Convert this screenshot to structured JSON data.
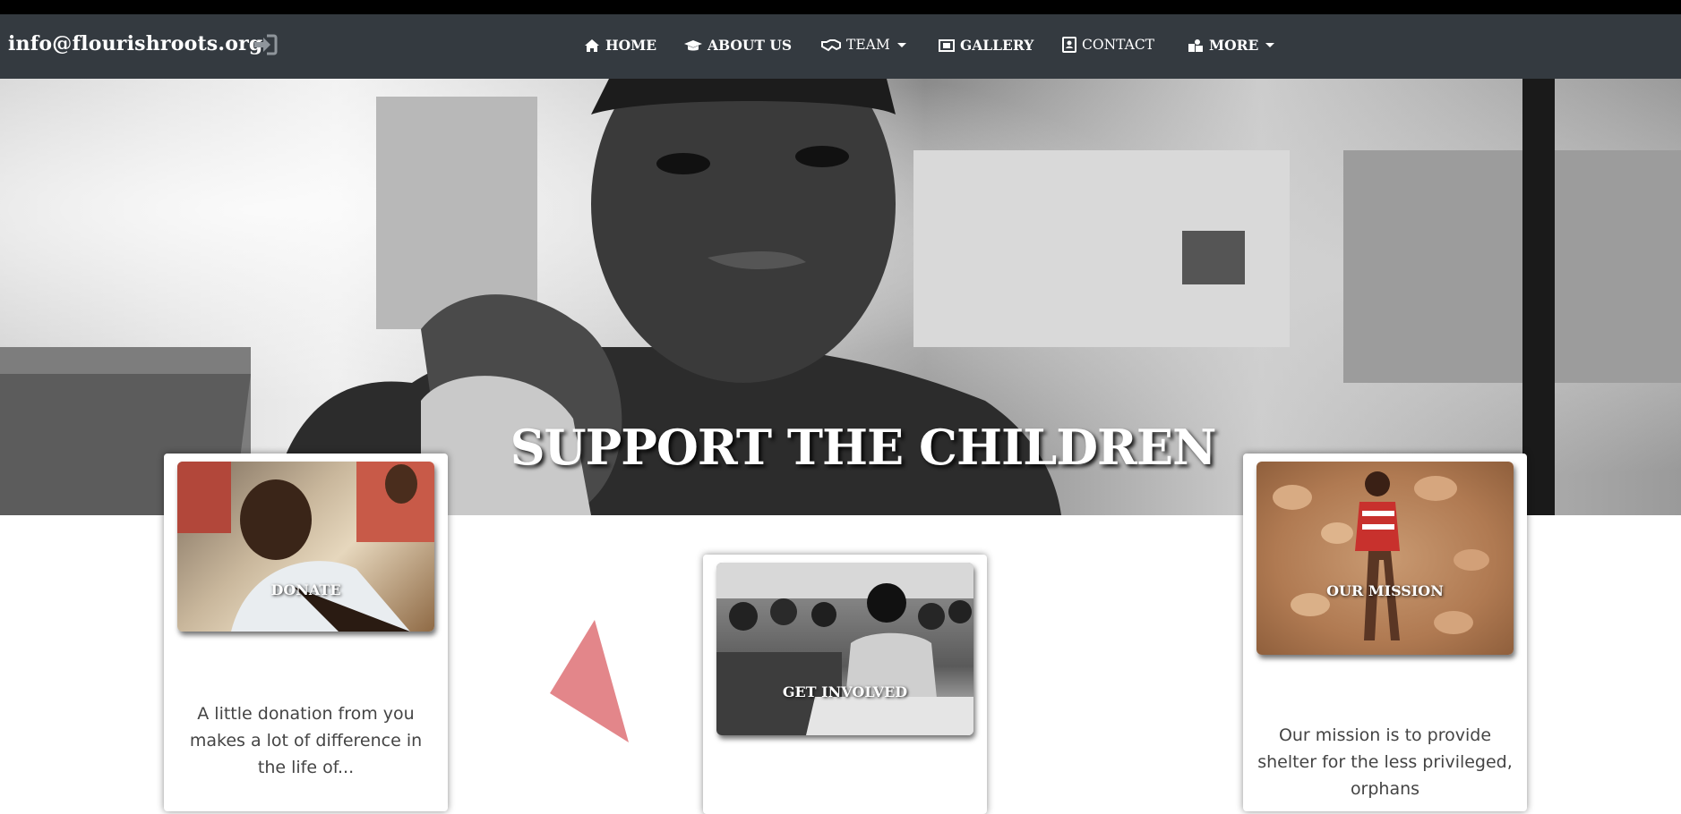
{
  "brand": {
    "email": "info@flourishroots.org",
    "login_icon": "sign-in-icon"
  },
  "nav": {
    "items": [
      {
        "label": "HOME",
        "icon": "home-icon",
        "dropdown": false
      },
      {
        "label": "ABOUT US",
        "icon": "graduation-cap-icon",
        "dropdown": false
      },
      {
        "label": "TEAM",
        "icon": "handshake-icon",
        "dropdown": true
      },
      {
        "label": "GALLERY",
        "icon": "film-icon",
        "dropdown": false
      },
      {
        "label": "CONTACT",
        "icon": "address-card-icon",
        "dropdown": false
      },
      {
        "label": "MORE",
        "icon": "users-icon",
        "dropdown": true
      }
    ]
  },
  "hero": {
    "title": "SUPPORT THE CHILDREN"
  },
  "cards": [
    {
      "label": "DONATE",
      "text": "A little donation from you makes a lot of difference in the life of..."
    },
    {
      "label": "GET INVOLVED",
      "text": ""
    },
    {
      "label": "OUR MISSION",
      "text": "Our mission is to provide shelter for the less privileged, orphans"
    }
  ],
  "colors": {
    "navbar": "#343a40",
    "triangle": "#e3868a"
  }
}
